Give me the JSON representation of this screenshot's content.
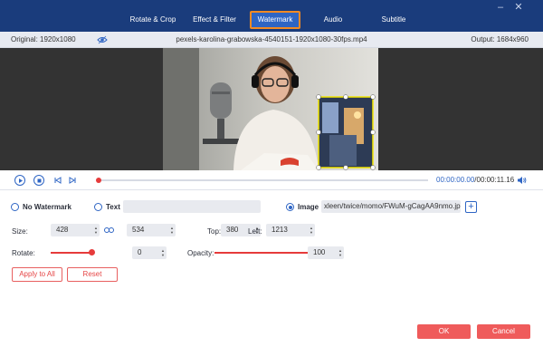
{
  "tabs": [
    {
      "label": "Rotate & Crop"
    },
    {
      "label": "Effect & Filter"
    },
    {
      "label": "Watermark"
    },
    {
      "label": "Audio"
    },
    {
      "label": "Subtitle"
    }
  ],
  "info": {
    "original": "Original: 1920x1080",
    "filename": "pexels-karolina-grabowska-4540151-1920x1080-30fps.mp4",
    "output": "Output: 1684x960"
  },
  "player": {
    "current_time": "00:00:00.00",
    "total_time": "/00:00:11.16",
    "progress": 0.0
  },
  "watermark": {
    "no_watermark_label": "No Watermark",
    "text_label": "Text",
    "text_value": "",
    "image_label": "Image",
    "image_path": "xleen/twice/momo/FWuM-gCagAA9nmo.jpg",
    "selected": "image"
  },
  "size": {
    "label": "Size:",
    "width": "428",
    "height": "534"
  },
  "position": {
    "top_label": "Top:",
    "top": "380",
    "left_label": "Left:",
    "left": "1213"
  },
  "rotate": {
    "label": "Rotate:",
    "value": "0",
    "level": 0.5
  },
  "opacity": {
    "label": "Opacity:",
    "value": "100",
    "level": 1.0
  },
  "buttons": {
    "apply_all": "Apply to All",
    "reset": "Reset",
    "ok": "OK",
    "cancel": "Cancel"
  },
  "colors": {
    "accent": "#2e65c4",
    "header": "#1a3c7c",
    "highlight": "#f28a24",
    "danger": "#ef5b5b",
    "watermark_frame": "#f2e600"
  }
}
